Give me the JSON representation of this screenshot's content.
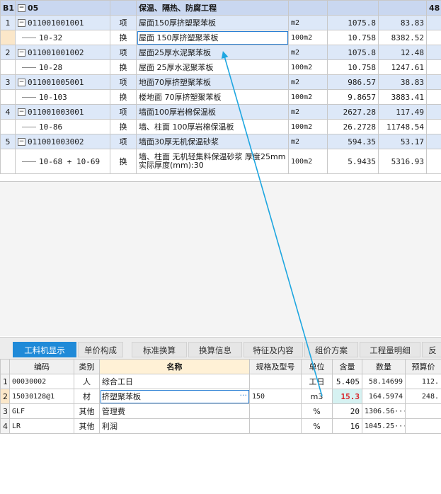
{
  "top_table": {
    "section": {
      "index": "B1",
      "code": "05",
      "name": "保温、隔热、防腐工程",
      "extra": "48"
    },
    "rows": [
      {
        "idx": "1",
        "code": "011001001001",
        "type": "项",
        "name": "屋面150厚挤塑聚苯板",
        "unit": "m2",
        "qty": "1075.8",
        "price": "83.83",
        "kind": "item"
      },
      {
        "idx": "",
        "code": "10-32",
        "type": "换",
        "name": "屋面 150厚挤塑聚苯板",
        "unit": "100m2",
        "qty": "10.758",
        "price": "8382.52",
        "kind": "sub",
        "selected": true
      },
      {
        "idx": "2",
        "code": "011001001002",
        "type": "项",
        "name": "屋面25厚水泥聚苯板",
        "unit": "m2",
        "qty": "1075.8",
        "price": "12.48",
        "kind": "item"
      },
      {
        "idx": "",
        "code": "10-28",
        "type": "换",
        "name": "屋面 25厚水泥聚苯板",
        "unit": "100m2",
        "qty": "10.758",
        "price": "1247.61",
        "kind": "sub"
      },
      {
        "idx": "3",
        "code": "011001005001",
        "type": "项",
        "name": "地面70厚挤塑聚苯板",
        "unit": "m2",
        "qty": "986.57",
        "price": "38.83",
        "kind": "item"
      },
      {
        "idx": "",
        "code": "10-103",
        "type": "换",
        "name": "楼地面 70厚挤塑聚苯板",
        "unit": "100m2",
        "qty": "9.8657",
        "price": "3883.41",
        "kind": "sub"
      },
      {
        "idx": "4",
        "code": "011001003001",
        "type": "项",
        "name": "墙面100厚岩棉保温板",
        "unit": "m2",
        "qty": "2627.28",
        "price": "117.49",
        "kind": "item"
      },
      {
        "idx": "",
        "code": "10-86",
        "type": "换",
        "name": "墙、柱面 100厚岩棉保温板",
        "unit": "100m2",
        "qty": "26.2728",
        "price": "11748.54",
        "kind": "sub"
      },
      {
        "idx": "5",
        "code": "011001003002",
        "type": "项",
        "name": "墙面30厚无机保温砂浆",
        "unit": "m2",
        "qty": "594.35",
        "price": "53.17",
        "kind": "item"
      },
      {
        "idx": "",
        "code": "10-68 + 10-69",
        "type": "换",
        "name": "墙、柱面 无机轻集料保温砂浆 厚度25mm 实际厚度(mm):30",
        "unit": "100m2",
        "qty": "5.9435",
        "price": "5316.93",
        "kind": "sub",
        "tall": true
      }
    ]
  },
  "tabs": [
    "工料机显示",
    "单价构成",
    "标准换算",
    "换算信息",
    "特征及内容",
    "组价方案",
    "工程量明细",
    "反"
  ],
  "bottom_table": {
    "headers": [
      "",
      "编码",
      "类别",
      "名称",
      "规格及型号",
      "单位",
      "含量",
      "数量",
      "预算价"
    ],
    "rows": [
      {
        "idx": "1",
        "code": "00030002",
        "type": "人",
        "name": "综合工日",
        "spec": "",
        "unit": "工日",
        "content": "5.405",
        "amount": "58.14699",
        "price": "112."
      },
      {
        "idx": "2",
        "code": "15030128@1",
        "type": "材",
        "name": "挤塑聚苯板",
        "spec": "150",
        "unit": "m3",
        "content": "15.3",
        "amount": "164.5974",
        "price": "248.",
        "editing": true,
        "dots": "···"
      },
      {
        "idx": "3",
        "code": "GLF",
        "type": "其他",
        "name": "管理费",
        "spec": "",
        "unit": "%",
        "content": "20",
        "amount": "1306.56···",
        "price": ""
      },
      {
        "idx": "4",
        "code": "LR",
        "type": "其他",
        "name": "利润",
        "spec": "",
        "unit": "%",
        "content": "16",
        "amount": "1045.25···",
        "price": ""
      }
    ]
  },
  "colors": {
    "accent": "#1f8ad8",
    "arrow": "#1ea6e0",
    "item_row": "#dde8f8",
    "section_row": "#c9d7f0",
    "highlight_value": "#d8232a"
  }
}
